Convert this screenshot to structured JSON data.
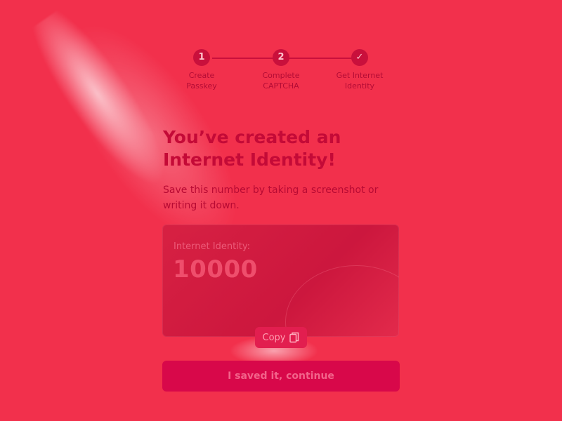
{
  "stepper": {
    "steps": [
      {
        "marker": "1",
        "label": "Create\nPasskey"
      },
      {
        "marker": "2",
        "label": "Complete\nCAPTCHA"
      },
      {
        "marker": "✓",
        "label": "Get Internet\nIdentity"
      }
    ]
  },
  "main": {
    "title": "You’ve created an\nInternet Identity!",
    "subtitle": "Save this number by taking a screenshot or writing it down."
  },
  "identity_card": {
    "label": "Internet Identity:",
    "number": "10000"
  },
  "actions": {
    "copy_label": "Copy",
    "continue_label": "I saved it, continue"
  },
  "colors": {
    "background": "#f2304c",
    "accent": "#c9103c",
    "button": "#d8084a"
  }
}
